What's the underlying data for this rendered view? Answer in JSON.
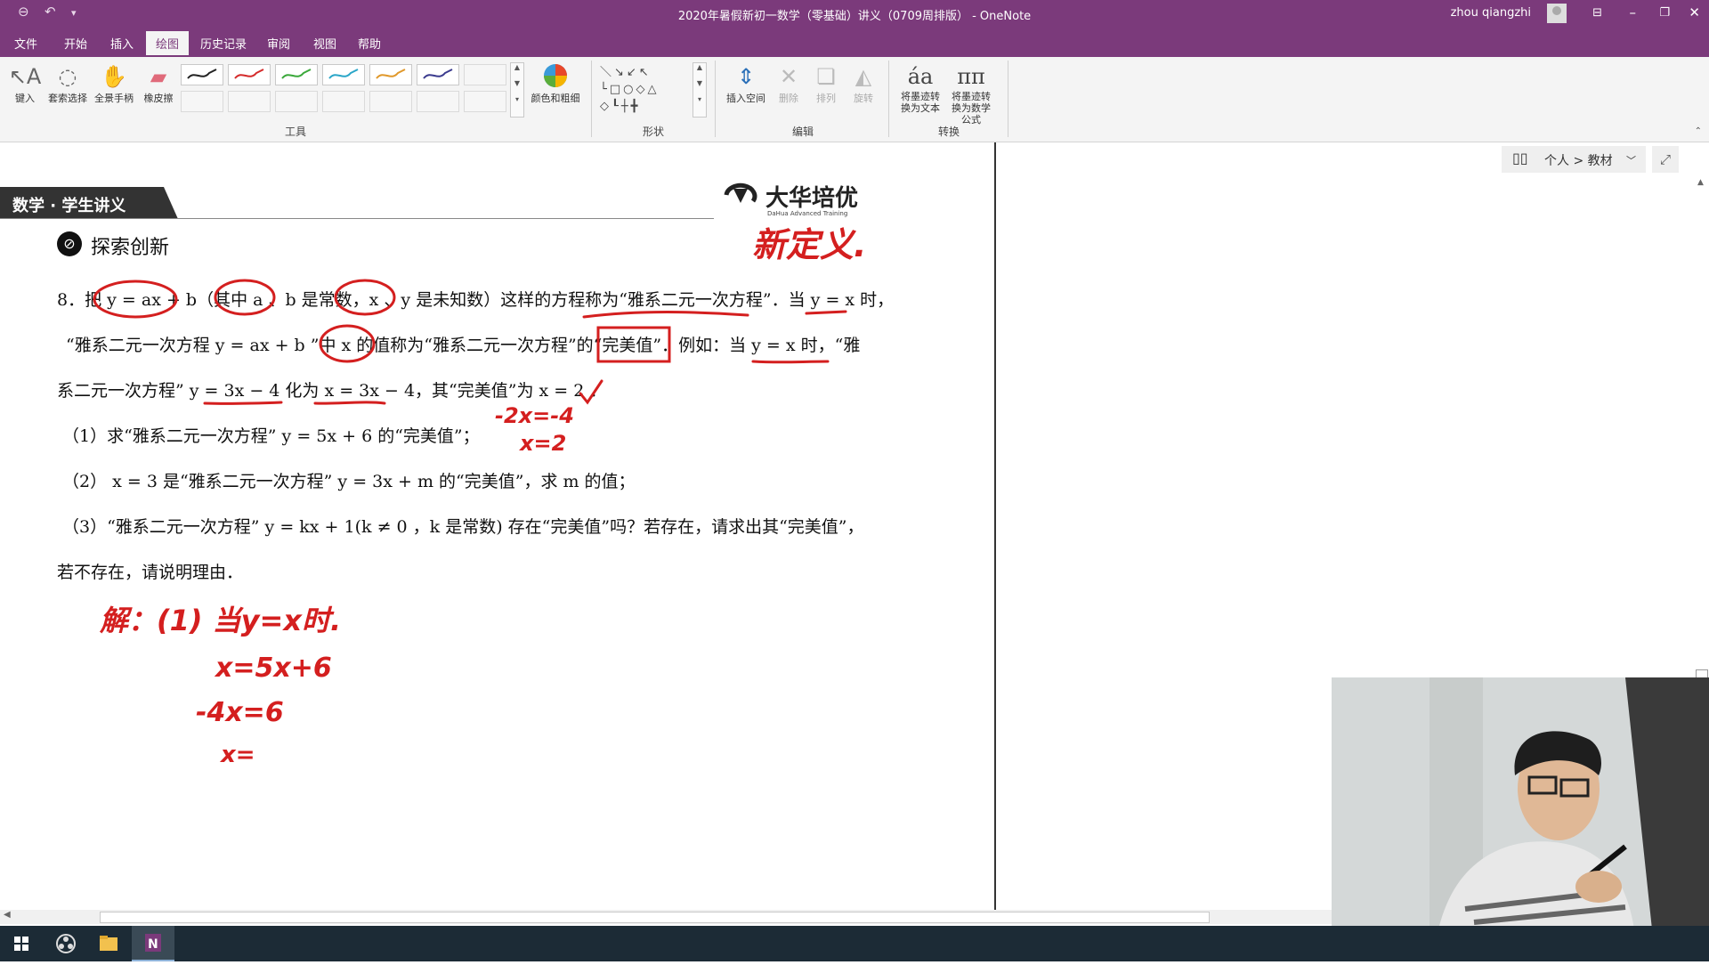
{
  "titlebar": {
    "document_title": "2020年暑假新初一数学（零基础）讲义（0709周排版） - OneNote",
    "user_name": "zhou qiangzhi"
  },
  "menu": {
    "tabs": [
      "文件",
      "开始",
      "插入",
      "绘图",
      "历史记录",
      "审阅",
      "视图",
      "帮助"
    ],
    "active": "绘图"
  },
  "ribbon": {
    "tools": {
      "type": "键入",
      "lasso": "套索选择",
      "pan": "全景手柄",
      "eraser": "橡皮擦"
    },
    "pen_colors": [
      "#222222",
      "#d42a2a",
      "#3aa83a",
      "#2aa6c8",
      "#e0982a",
      "#3b3b8e"
    ],
    "color_thickness": "颜色和粗细",
    "group_tools": "工具",
    "group_shapes": "形状",
    "insert_space": "插入空间",
    "delete": "删除",
    "arrange": "排列",
    "rotate": "旋转",
    "group_edit": "编辑",
    "ink_to_text": "将墨迹转换为文本",
    "ink_to_math": "将墨迹转换为数学公式",
    "group_convert": "转换"
  },
  "notebook": {
    "path": "个人 > 教材"
  },
  "page": {
    "header_label": "数学 · 学生讲义",
    "logo_name": "大华培优",
    "logo_sub": "DaHua Advanced Training",
    "section_title": "探索创新",
    "problem": {
      "line1": "8．把 y = ax + b（其中 a 、b 是常数，x 、y 是未知数）这样的方程称为“雅系二元一次方程”．当 y = x 时，",
      "line2": "“雅系二元一次方程 y = ax + b ”中 x 的值称为“雅系二元一次方程”的“完美值”．例如：当 y = x 时，“雅",
      "line3": "系二元一次方程” y = 3x − 4 化为 x = 3x − 4，其“完美值”为 x = 2 ．",
      "q1": "（1）求“雅系二元一次方程” y = 5x + 6 的“完美值”；",
      "q2": "（2） x = 3 是“雅系二元一次方程” y = 3x + m 的“完美值”，求 m 的值；",
      "q3": "（3）“雅系二元一次方程” y = kx + 1(k ≠ 0 ，k 是常数) 存在“完美值”吗？若存在，请求出其“完美值”，",
      "q3b": "若不存在，请说明理由．"
    },
    "ink_notes": {
      "new_definition": "新定义.",
      "work1": "-2x=-4",
      "work2": "x=2",
      "sol1": "解：(1) 当y=x时.",
      "sol2": "x=5x+6",
      "sol3": "-4x=6",
      "sol4": "x="
    }
  },
  "colors": {
    "accent": "#7b3a7b",
    "ink": "#d41f1f"
  }
}
